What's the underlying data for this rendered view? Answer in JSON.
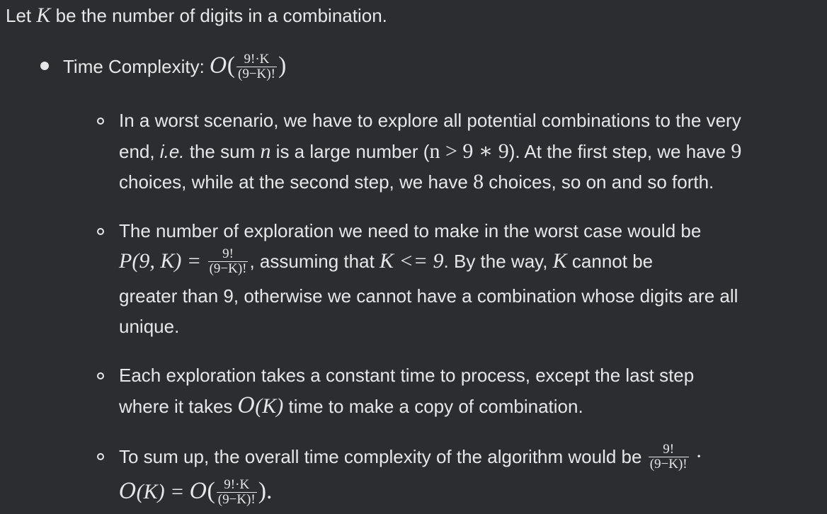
{
  "intro": {
    "t1": "Let ",
    "K": "K",
    "t2": " be the number of digits in a combination."
  },
  "time": {
    "label": "Time Complexity: ",
    "O": "O",
    "open": "(",
    "frac_num": "9!·K",
    "frac_den": "(9−K)!",
    "close": ")"
  },
  "sub1": {
    "line1": "In a worst scenario, we have to explore all potential combinations to the very",
    "l2a": "end, ",
    "ie": "i.e.",
    "l2b": " the sum ",
    "n": "n",
    "l2c": " is a large number (",
    "cond": "n > 9 ∗ 9",
    "l2d": "). At the first step, we have ",
    "nine": "9",
    "l3a": "choices, while at the second step, we have ",
    "eight": "8",
    "l3b": " choices, so on and so forth."
  },
  "sub2": {
    "line1": "The number of exploration we need to make in the worst case would be",
    "perm": "P(9, K) = ",
    "frac_num": "9!",
    "frac_den": "(9−K)!",
    "l2b": ", assuming that ",
    "cond": "K <= 9",
    "l2c": ". By the way, ",
    "K": "K",
    "l2d": " cannot be",
    "line3": "greater than 9, otherwise we cannot have a combination whose digits are all",
    "line4": "unique."
  },
  "sub3": {
    "line1": "Each exploration takes a constant time to process, except the last step",
    "l2a": "where it takes ",
    "O": "O",
    "OK": "(K)",
    "l2b": " time to make a copy of combination."
  },
  "sub4": {
    "line1": "To sum up, the overall time complexity of the algorithm would be ",
    "frac_num": "9!",
    "frac_den": "(9−K)!",
    "dot": " ·",
    "O1": "O",
    "eq": "(K) = ",
    "O2": "O",
    "open": "(",
    "frac2_num": "9!·K",
    "frac2_den": "(9−K)!",
    "close": ").",
    "period": ""
  }
}
